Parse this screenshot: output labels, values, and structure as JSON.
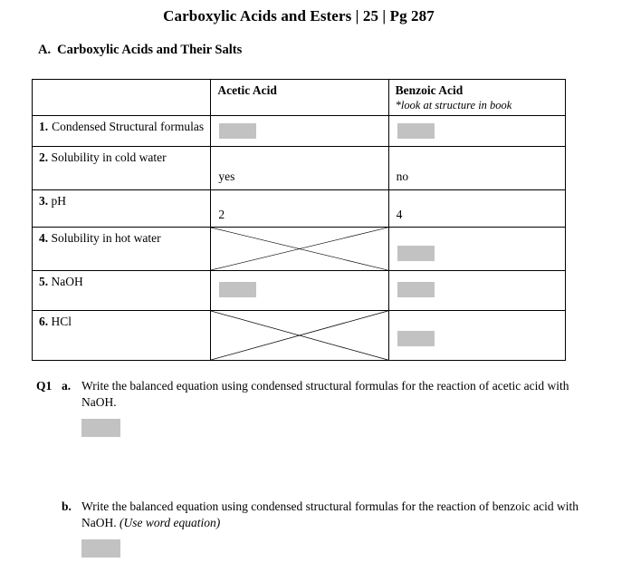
{
  "document": {
    "title": "Carboxylic Acids and Esters | 25 | Pg 287",
    "section": {
      "letter": "A.",
      "heading": "Carboxylic Acids and Their Salts"
    }
  },
  "table": {
    "header": {
      "label_column": "",
      "acetic": "Acetic Acid",
      "benzoic": "Benzoic Acid",
      "benzoic_note": "*look at structure in book"
    },
    "rows": [
      {
        "number": "1.",
        "label": "Condensed Structural formulas",
        "acetic": "",
        "acetic_type": "redacted",
        "benzoic": "",
        "benzoic_type": "redacted"
      },
      {
        "number": "2.",
        "label": "Solubility in cold water",
        "acetic": "yes",
        "acetic_type": "text",
        "benzoic": "no",
        "benzoic_type": "text"
      },
      {
        "number": "3.",
        "label": "pH",
        "acetic": "2",
        "acetic_type": "text",
        "benzoic": "4",
        "benzoic_type": "text"
      },
      {
        "number": "4.",
        "label": "Solubility in hot water",
        "acetic": "",
        "acetic_type": "crossed-out",
        "benzoic": "",
        "benzoic_type": "redacted"
      },
      {
        "number": "5.",
        "label": "NaOH",
        "acetic": "",
        "acetic_type": "redacted",
        "benzoic": "",
        "benzoic_type": "redacted"
      },
      {
        "number": "6.",
        "label": "HCl",
        "acetic": "",
        "acetic_type": "crossed-out",
        "benzoic": "",
        "benzoic_type": "redacted"
      }
    ]
  },
  "questions": {
    "q1": {
      "tag": "Q1",
      "parts": [
        {
          "letter": "a.",
          "text": "Write the balanced equation using condensed structural formulas for the reaction of acetic acid with NaOH.",
          "italic_suffix": "",
          "answer": ""
        },
        {
          "letter": "b.",
          "text": "Write the balanced equation using condensed structural formulas for the reaction of benzoic acid with NaOH.",
          "italic_suffix": "(Use word equation)",
          "answer": ""
        }
      ]
    }
  },
  "colors": {
    "redaction_gray": "#c2c2c2",
    "border": "#000000",
    "text": "#000000",
    "background": "#ffffff"
  }
}
